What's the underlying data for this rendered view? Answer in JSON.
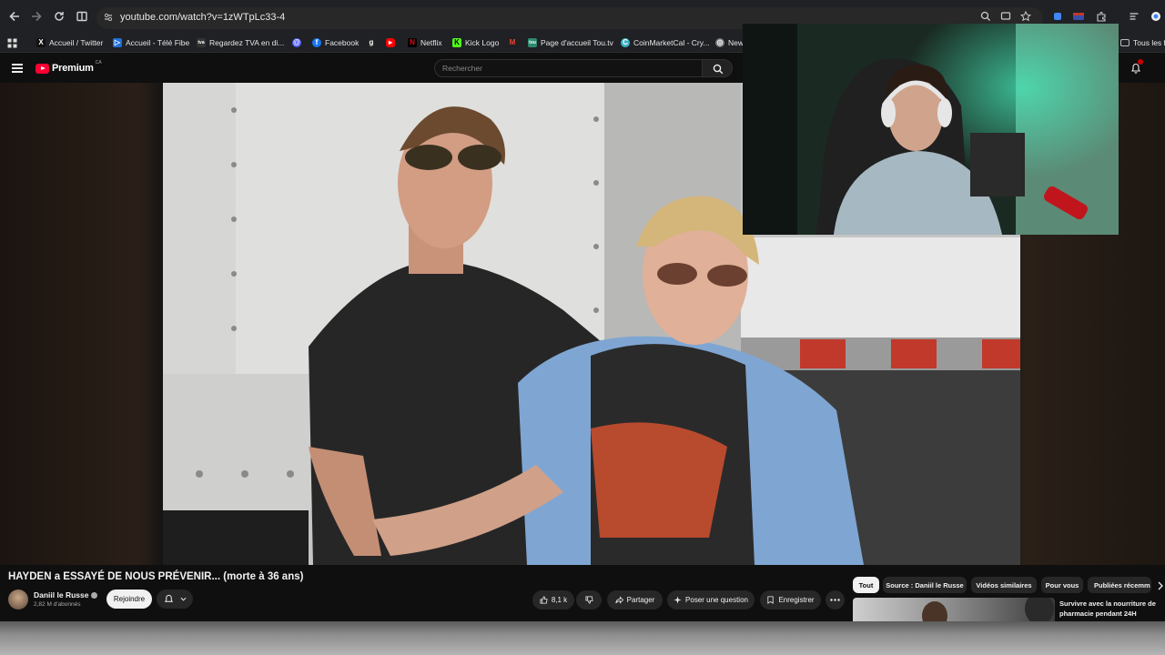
{
  "browser": {
    "url": "youtube.com/watch?v=1zWTpLc33-4",
    "bookmarks": [
      {
        "label": "Accueil / Twitter",
        "icon": "x-icon",
        "color": "#000000"
      },
      {
        "label": "Accueil - Télé Fibe",
        "icon": "fibe-icon",
        "color": "#1f6fd6"
      },
      {
        "label": "Regardez TVA en di...",
        "icon": "tva-icon",
        "color": "#333333"
      },
      {
        "label": "",
        "icon": "threads-icon",
        "color": "#4a5cf5"
      },
      {
        "label": "Facebook",
        "icon": "facebook-icon",
        "color": "#1877f2"
      },
      {
        "label": "",
        "icon": "g-icon",
        "color": "#222222"
      },
      {
        "label": "",
        "icon": "youtube-icon",
        "color": "#ff0000"
      },
      {
        "label": "Netflix",
        "icon": "netflix-icon",
        "color": "#e50914"
      },
      {
        "label": "Kick Logo",
        "icon": "kick-icon",
        "color": "#53fc18"
      },
      {
        "label": "",
        "icon": "gmail-icon",
        "color": "#ea4335"
      },
      {
        "label": "Page d'accueil Tou.tv",
        "icon": "toutv-icon",
        "color": "#2d8a6e"
      },
      {
        "label": "CoinMarketCal - Cry...",
        "icon": "coin-icon",
        "color": "#3ab3c8"
      },
      {
        "label": "",
        "icon": "globe-icon",
        "color": "#777777"
      },
      {
        "label": "New",
        "icon": "folder-icon",
        "color": "#888888"
      }
    ],
    "all_bookmarks": "Tous les f"
  },
  "youtube": {
    "logo_text": "Premium",
    "region": "CA",
    "search_placeholder": "Rechercher",
    "video_title": "HAYDEN a ESSAYÉ DE NOUS PRÉVENIR... (morte à 36 ans)",
    "channel_name": "Daniil le Russe",
    "subscribers": "2,82 M d'abonnés",
    "join_label": "Rejoindre",
    "likes": "8,1 k",
    "share_label": "Partager",
    "ask_label": "Poser une question",
    "save_label": "Enregistrer",
    "chips": [
      "Tout",
      "Source : Daniil le Russe",
      "Vidéos similaires",
      "Pour vous",
      "Publiées récemm"
    ],
    "reco_title": "Survivre avec la nourriture de pharmacie pendant 24H"
  }
}
